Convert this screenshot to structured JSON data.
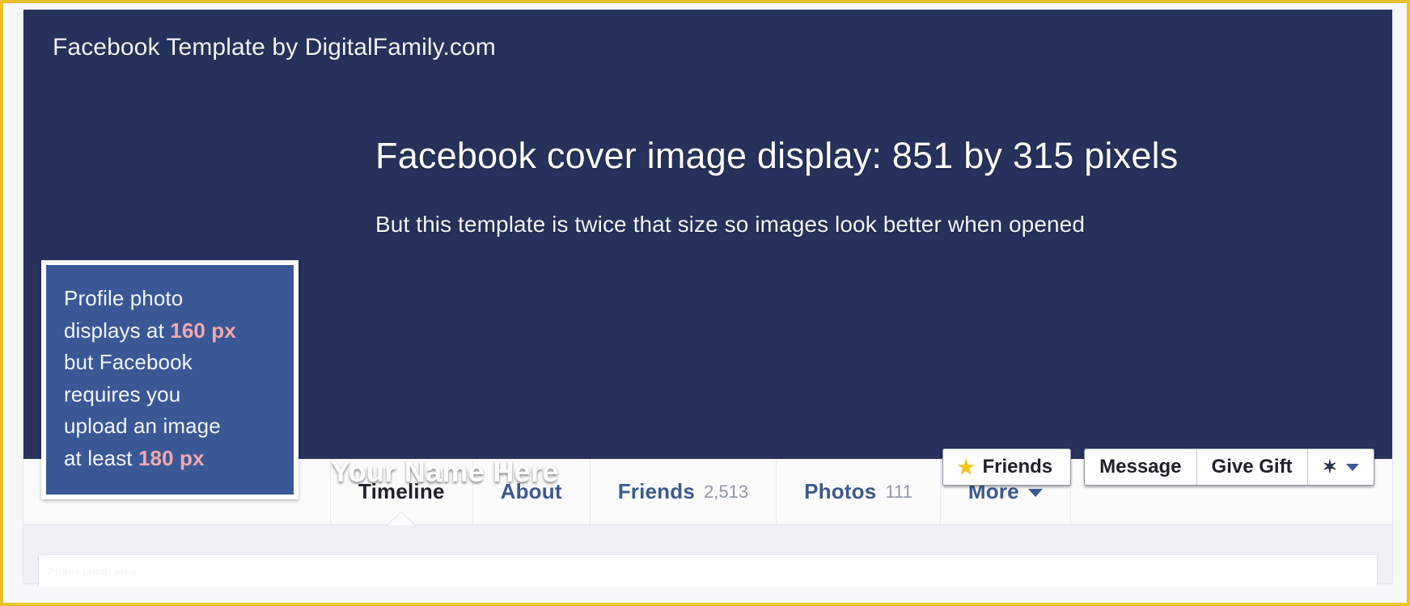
{
  "theme": {
    "frame_border": "#e8c22a",
    "cover_bg": "#26325c",
    "profile_box_bg": "#3a5796",
    "accent_pink": "#f2a8ae",
    "tab_link_blue": "#3b5a8e",
    "star_yellow": "#f5c518"
  },
  "cover": {
    "credit": "Facebook Template by DigitalFamily.com",
    "headline": "Facebook cover image display: 851 by 315 pixels",
    "subline": "But this template is twice that size so images look better when opened"
  },
  "profile": {
    "name": "Your Name Here",
    "callout": {
      "line1": "Profile photo",
      "line2_prefix": "displays at ",
      "line2_value": "160 px",
      "line3": "but Facebook",
      "line4": "requires you",
      "line5": "upload an image",
      "line6_prefix": "at least ",
      "line6_value": "180 px"
    },
    "faint_caption": "Profile photo area"
  },
  "actions": {
    "friends_label": "Friends",
    "friends_icon": "star-icon",
    "message_label": "Message",
    "give_gift_label": "Give Gift",
    "gear_icon": "gear-icon",
    "gear_caret_icon": "caret-down-icon"
  },
  "tabs": [
    {
      "label": "Timeline",
      "count": "",
      "active": true,
      "caret": false
    },
    {
      "label": "About",
      "count": "",
      "active": false,
      "caret": false
    },
    {
      "label": "Friends",
      "count": "2,513",
      "active": false,
      "caret": false
    },
    {
      "label": "Photos",
      "count": "111",
      "active": false,
      "caret": false
    },
    {
      "label": "More",
      "count": "",
      "active": false,
      "caret": true
    }
  ]
}
